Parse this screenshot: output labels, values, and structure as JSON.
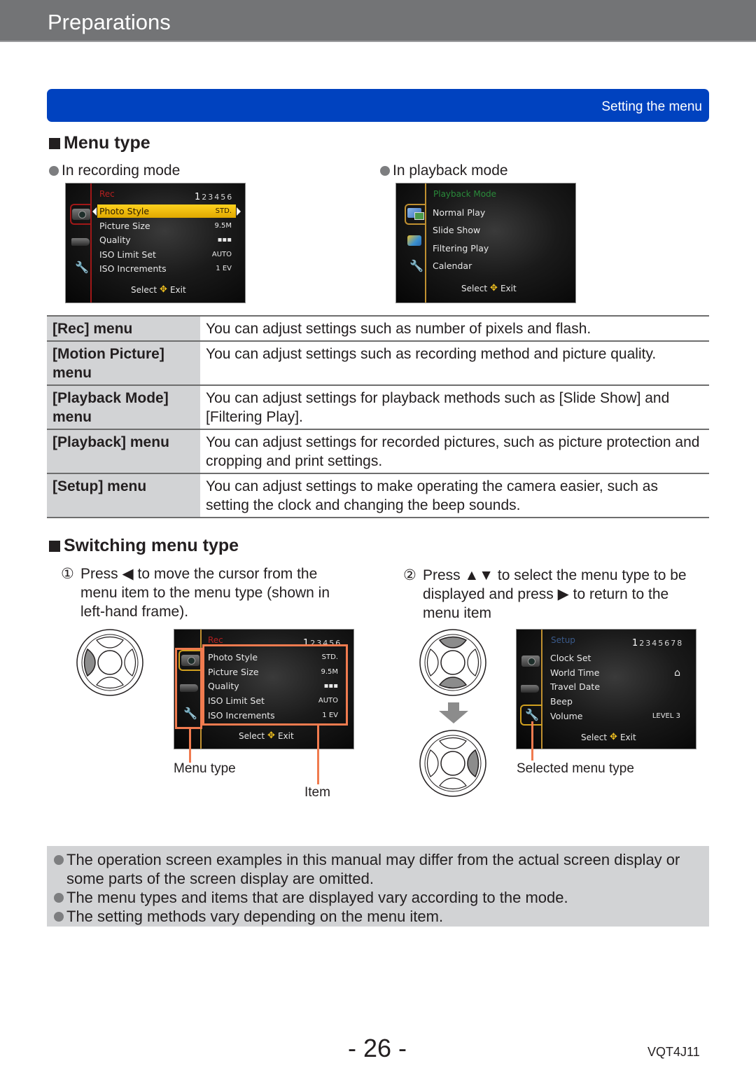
{
  "header": {
    "title": "Preparations"
  },
  "section_band": {
    "label": "Setting the menu",
    "color": "#0042bf"
  },
  "menu_type": {
    "heading": "Menu type",
    "recording_label": "In recording mode",
    "playback_label": "In playback mode",
    "recording_screen": {
      "header": "Rec",
      "pages_current": "1",
      "pages_rest": "23456",
      "items": [
        {
          "label": "Photo Style",
          "value": "STD.",
          "selected": true
        },
        {
          "label": "Picture Size",
          "value": "9.5M"
        },
        {
          "label": "Quality",
          "value": "▪▪▪"
        },
        {
          "label": "ISO Limit Set",
          "value": "AUTO"
        },
        {
          "label": "ISO Increments",
          "value": "1 EV"
        }
      ],
      "footer_select": "Select",
      "footer_exit": "Exit",
      "tabs": [
        "camera-icon",
        "video-camera-icon",
        "wrench-icon"
      ]
    },
    "playback_screen": {
      "header": "Playback Mode",
      "items": [
        {
          "label": "Normal Play"
        },
        {
          "label": "Slide Show"
        },
        {
          "label": "Filtering Play"
        },
        {
          "label": "Calendar"
        }
      ],
      "footer_select": "Select",
      "footer_exit": "Exit",
      "tabs": [
        "playback-mode-icon",
        "playback-folder-icon",
        "wrench-icon"
      ]
    }
  },
  "menu_table": {
    "rows": [
      {
        "name": "[Rec] menu",
        "desc": "You can adjust settings such as number of pixels and flash."
      },
      {
        "name": "[Motion Picture] menu",
        "desc": "You can adjust settings such as recording method and picture quality."
      },
      {
        "name": "[Playback Mode] menu",
        "desc": "You can adjust settings for playback methods such as [Slide Show] and [Filtering Play]."
      },
      {
        "name": "[Playback] menu",
        "desc": "You can adjust settings for recorded pictures, such as picture protection and cropping and print settings."
      },
      {
        "name": "[Setup] menu",
        "desc": "You can adjust settings to make operating the camera easier, such as setting the clock and changing the beep sounds."
      }
    ]
  },
  "switching": {
    "heading": "Switching menu type",
    "step1": {
      "num": "①",
      "text": "Press ◀ to move the cursor from the menu item to the menu type (shown in left-hand frame)."
    },
    "step2": {
      "num": "②",
      "text": "Press ▲▼ to select the menu type to be displayed and press ▶ to return to the menu item"
    },
    "screen1": {
      "header": "Rec",
      "pages_current": "1",
      "pages_rest": "23456",
      "items": [
        {
          "label": "Photo Style",
          "value": "STD."
        },
        {
          "label": "Picture Size",
          "value": "9.5M"
        },
        {
          "label": "Quality",
          "value": "▪▪▪"
        },
        {
          "label": "ISO Limit Set",
          "value": "AUTO"
        },
        {
          "label": "ISO Increments",
          "value": "1 EV"
        }
      ],
      "footer_select": "Select",
      "footer_exit": "Exit"
    },
    "screen2": {
      "header": "Setup",
      "pages_current": "1",
      "pages_rest": "2345678",
      "items": [
        {
          "label": "Clock Set",
          "value": ""
        },
        {
          "label": "World Time",
          "value": "⌂"
        },
        {
          "label": "Travel Date",
          "value": ""
        },
        {
          "label": "Beep",
          "value": ""
        },
        {
          "label": "Volume",
          "value": "LEVEL 3"
        }
      ],
      "footer_select": "Select",
      "footer_exit": "Exit"
    },
    "caption_menu_type": "Menu type",
    "caption_item": "Item",
    "caption_selected": "Selected menu type",
    "callout_color": "#f07b4f"
  },
  "notes": [
    "The operation screen examples in this manual may differ from the actual screen display or some parts of the screen display are omitted.",
    "The menu types and items that are displayed vary according to the mode.",
    "The setting methods vary depending on the menu item."
  ],
  "footer": {
    "page_number": "- 26 -",
    "doc_code": "VQT4J11"
  }
}
